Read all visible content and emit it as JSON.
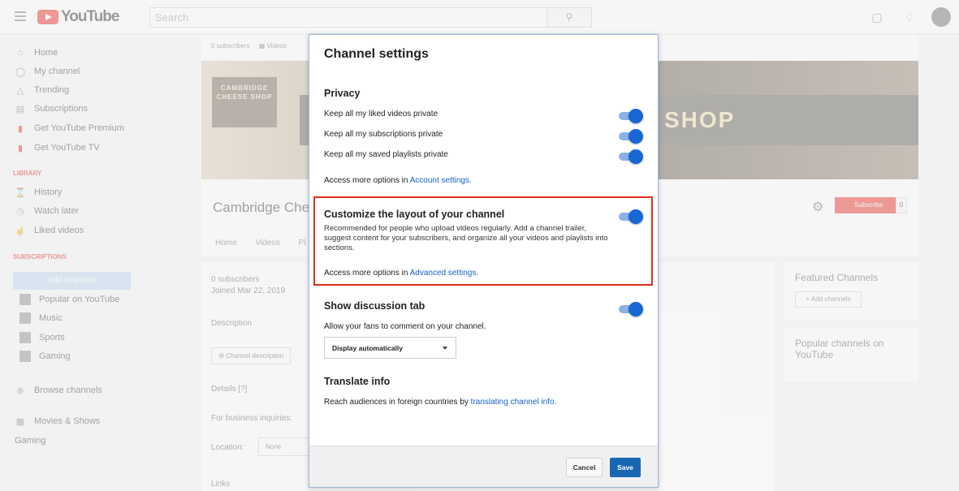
{
  "topbar": {
    "logo_text": "YouTube",
    "search_placeholder": "Search"
  },
  "sidebar": {
    "items": [
      {
        "label": "Home",
        "icon": "home-icon"
      },
      {
        "label": "My channel",
        "icon": "account-icon"
      },
      {
        "label": "Trending",
        "icon": "flame-icon"
      },
      {
        "label": "Subscriptions",
        "icon": "subscriptions-icon"
      },
      {
        "label": "Get YouTube Premium",
        "icon": "youtube-red-icon"
      },
      {
        "label": "Get YouTube TV",
        "icon": "youtube-tv-icon"
      }
    ],
    "library_heading": "LIBRARY",
    "library_items": [
      {
        "label": "History",
        "icon": "hourglass-icon"
      },
      {
        "label": "Watch later",
        "icon": "clock-icon"
      },
      {
        "label": "Liked videos",
        "icon": "thumbs-up-icon"
      }
    ],
    "subscriptions_heading": "SUBSCRIPTIONS",
    "add_channels_label": "Add channels",
    "subscription_items": [
      "Popular on YouTube",
      "Music",
      "Sports",
      "Gaming"
    ],
    "browse_channels": "Browse channels",
    "movies_shows": "Movies & Shows",
    "gaming": "Gaming"
  },
  "channel": {
    "strip_subscribers": "0 subscribers",
    "strip_videos": "Videos",
    "banner_logo": "CAMBRIDGE CHEESE SHOP",
    "banner_text": "SHOP",
    "name": "Cambridge Chee",
    "tabs": "Home Videos Pl",
    "subscribe_label": "Subscribe",
    "subscribe_count": "0",
    "about_subscribers": "0 subscribers",
    "about_joined": "Joined Mar 22, 2019",
    "description_label": "Description",
    "channel_description_btn": "Channel description",
    "details_label": "Details [?]",
    "business_label": "For business inquiries:",
    "location_label": "Location:",
    "location_value": "None",
    "links_label": "Links",
    "featured_channels": "Featured Channels",
    "add_channels_btn": "+ Add channels",
    "popular_channels": "Popular channels on YouTube"
  },
  "modal": {
    "title": "Channel settings",
    "privacy": {
      "heading": "Privacy",
      "rows": [
        {
          "label": "Keep all my liked videos private",
          "on": true
        },
        {
          "label": "Keep all my subscriptions private",
          "on": true
        },
        {
          "label": "Keep all my saved playlists private",
          "on": true
        }
      ],
      "more_prefix": "Access more options in ",
      "more_link": "Account settings."
    },
    "layout": {
      "heading": "Customize the layout of your channel",
      "on": true,
      "description": "Recommended for people who upload videos regularly. Add a channel trailer, suggest content for your subscribers, and organize all your videos and playlists into sections.",
      "more_prefix": "Access more options in ",
      "more_link": "Advanced settings."
    },
    "discussion": {
      "heading": "Show discussion tab",
      "on": true,
      "description": "Allow your fans to comment on your channel.",
      "select_value": "Display automatically"
    },
    "translate": {
      "heading": "Translate info",
      "prefix": "Reach audiences in foreign countries by ",
      "link": "translating channel info."
    },
    "cancel_label": "Cancel",
    "save_label": "Save"
  },
  "colors": {
    "accent_blue": "#1967d2",
    "highlight_red": "#e0301e",
    "youtube_red": "#e62117"
  }
}
